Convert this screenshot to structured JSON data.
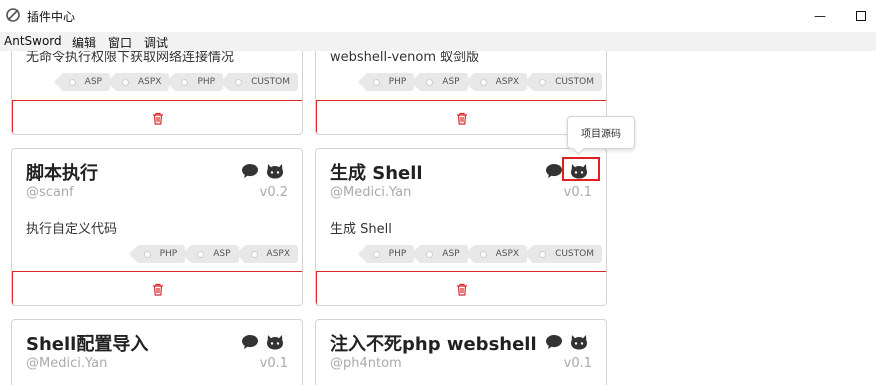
{
  "window": {
    "title": "插件中心",
    "min_glyph": "—",
    "max_glyph": "☐"
  },
  "menubar": [
    "AntSword",
    "编辑",
    "窗口",
    "调试"
  ],
  "colors": {
    "delete_red": "#db2828",
    "highlight_red": "#e02020",
    "icon_dark": "#333333",
    "tag_bg": "#e8e8e8"
  },
  "cards": [
    {
      "name": "",
      "author": "",
      "version": "",
      "description": "无命令执行权限下获取网络连接情况",
      "tags": [
        "ASP",
        "ASPX",
        "PHP",
        "CUSTOM"
      ],
      "delete_icon": "trash-icon"
    },
    {
      "name": "",
      "author": "",
      "version": "",
      "description": "webshell-venom 蚁剑版",
      "tags": [
        "PHP",
        "ASP",
        "ASPX",
        "CUSTOM"
      ],
      "delete_icon": "trash-icon"
    },
    {
      "name": "脚本执行",
      "author": "@scanf",
      "version": "v0.2",
      "description": "执行自定义代码",
      "tags": [
        "PHP",
        "ASP",
        "ASPX"
      ],
      "delete_icon": "trash-icon"
    },
    {
      "name": "生成 Shell",
      "author": "@Medici.Yan",
      "version": "v0.1",
      "description": "生成 Shell",
      "tags": [
        "PHP",
        "ASP",
        "ASPX",
        "CUSTOM"
      ],
      "delete_icon": "trash-icon"
    },
    {
      "name": "Shell配置导入",
      "author": "@Medici.Yan",
      "version": "v0.1",
      "description": "",
      "tags": [],
      "delete_icon": "trash-icon"
    },
    {
      "name": "注入不死php webshell",
      "author": "@ph4ntom",
      "version": "v0.1",
      "description": "",
      "tags": [],
      "delete_icon": "trash-icon"
    }
  ],
  "tooltip": {
    "text": "项目源码"
  }
}
